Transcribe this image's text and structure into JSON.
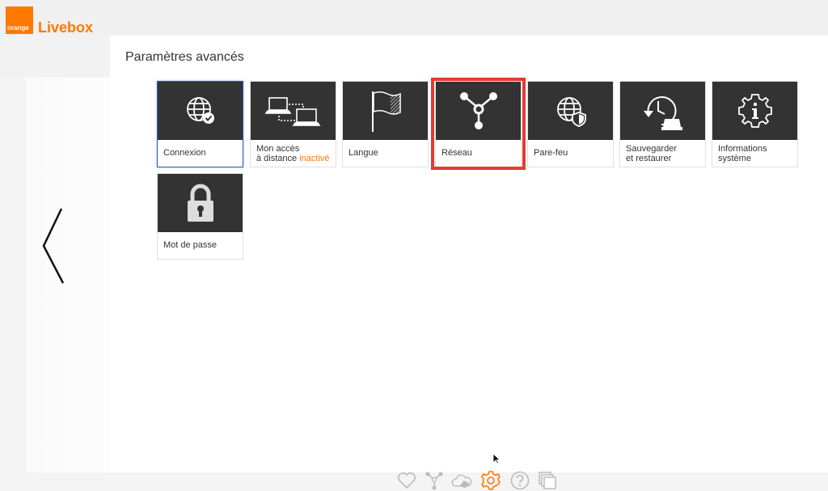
{
  "brand": {
    "logo_text": "orange",
    "product": "Livebox",
    "color": "#ff7900"
  },
  "page": {
    "title": "Paramètres avancés"
  },
  "tiles": [
    {
      "id": "connexion",
      "label_line1": "Connexion",
      "label_line2": "",
      "icon": "globe-check-icon",
      "selected": true
    },
    {
      "id": "remote",
      "label_line1": "Mon accès",
      "label_line2": "à distance",
      "status": "inactivé",
      "icon": "remote-computers-icon"
    },
    {
      "id": "langue",
      "label_line1": "Langue",
      "label_line2": "",
      "icon": "flag-icon"
    },
    {
      "id": "reseau",
      "label_line1": "Réseau",
      "label_line2": "",
      "icon": "network-nodes-icon",
      "highlighted": true
    },
    {
      "id": "parefeu",
      "label_line1": "Pare-feu",
      "label_line2": "",
      "icon": "globe-shield-icon"
    },
    {
      "id": "sauvegarder",
      "label_line1": "Sauvegarder",
      "label_line2": "et restaurer",
      "icon": "backup-restore-icon"
    },
    {
      "id": "informations",
      "label_line1": "Informations",
      "label_line2": "système",
      "icon": "info-gear-icon"
    },
    {
      "id": "motdepasse",
      "label_line1": "Mot de passe",
      "label_line2": "",
      "icon": "padlock-icon"
    }
  ],
  "dock": [
    "heart-icon",
    "network-icon",
    "cloud-icon",
    "settings-gear-icon",
    "help-icon",
    "windows-icon"
  ],
  "colors": {
    "tile_bg": "#333333",
    "highlight": "#e23c2f",
    "selected_border": "#2d5bbf",
    "dock_icon": "#bbbbbb",
    "dock_active": "#ff7900"
  }
}
